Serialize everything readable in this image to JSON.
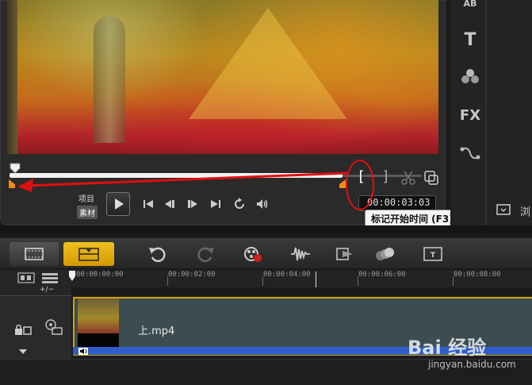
{
  "preview": {
    "label_project": "项目",
    "label_clip": "素材",
    "timecode": "00:00:03:03",
    "tooltip": "标记开始时间 (F3)",
    "mark_in_glyph": "[",
    "mark_out_glyph": "]",
    "scrubber_position": 0.0,
    "mark_in_position": 0.0,
    "mark_out_position": 1.0
  },
  "right_panel": {
    "icons": [
      "text-ab-icon",
      "title-t-icon",
      "graphics-icon",
      "fx-icon",
      "path-icon"
    ],
    "fx_label": "FX",
    "t_label": "T",
    "ab_label": "AB",
    "browse_label": "浏"
  },
  "toolbar": {
    "tabs": [
      "storyboard-view",
      "timeline-view"
    ],
    "active_tab": "timeline-view",
    "tools": [
      "undo-icon",
      "redo-icon",
      "record-capture-icon",
      "sound-mixer-icon",
      "auto-music-icon",
      "motion-track-icon",
      "subtitle-icon"
    ]
  },
  "timeline": {
    "ruler_labels": [
      "00:00:00:00",
      "00:00:02:00",
      "00:00:04:00",
      "00:00:06:00",
      "00:00:08:00"
    ],
    "add_remove_label": "+/−",
    "clip_name": "上.mp4"
  },
  "watermark": {
    "text": "Bai 经验",
    "url": "jingyan.baidu.com"
  },
  "colors": {
    "accent": "#e6b412",
    "annotation_red": "#e01010",
    "audio_bar": "#2f5cc8",
    "mark_handle": "#f08a10"
  }
}
